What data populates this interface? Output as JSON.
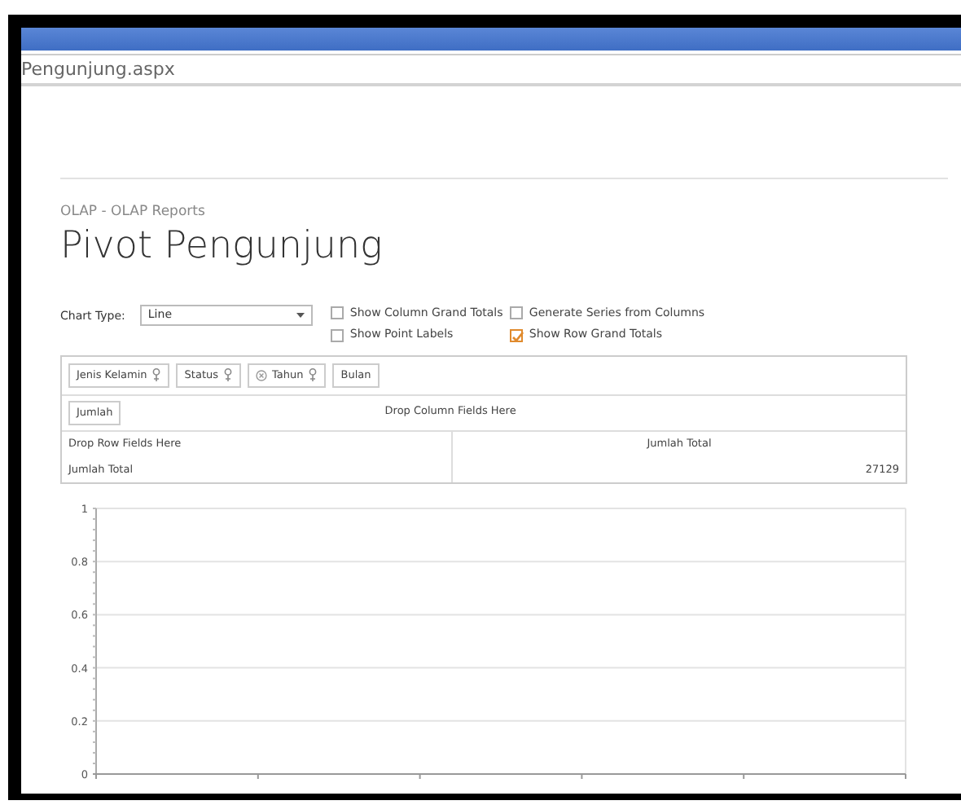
{
  "browser": {
    "address": "Pengunjung.aspx"
  },
  "breadcrumb": "OLAP - OLAP Reports",
  "title": "Pivot Pengunjung",
  "chart_type": {
    "label": "Chart Type:",
    "value": "Line"
  },
  "options": [
    {
      "label": "Show Column Grand Totals",
      "checked": false
    },
    {
      "label": "Generate Series from Columns",
      "checked": false
    },
    {
      "label": "Show Point Labels",
      "checked": false
    },
    {
      "label": "Show Row Grand Totals",
      "checked": true
    }
  ],
  "filter_fields": [
    {
      "label": "Jenis Kelamin",
      "collapse_button": false,
      "filter_icon": true
    },
    {
      "label": "Status",
      "collapse_button": false,
      "filter_icon": true
    },
    {
      "label": "Tahun",
      "collapse_button": true,
      "filter_icon": true
    },
    {
      "label": "Bulan",
      "collapse_button": false,
      "filter_icon": false
    }
  ],
  "data_field": "Jumlah",
  "column_drop": "Drop Column Fields Here",
  "row_drop": "Drop Row Fields Here",
  "column_total_header": "Jumlah Total",
  "rows": [
    {
      "label": "Jumlah Total",
      "value": "27129"
    }
  ],
  "chart": {
    "chart_data": {
      "type": "line",
      "categories": [
        null,
        null,
        null,
        null,
        null
      ],
      "ylim": [
        0,
        1
      ],
      "yticks": [
        0,
        0.2,
        0.4,
        0.6,
        0.8,
        1
      ],
      "grid": true,
      "series": [
        {
          "values": [
            null,
            null,
            null,
            null,
            null
          ]
        }
      ]
    }
  }
}
